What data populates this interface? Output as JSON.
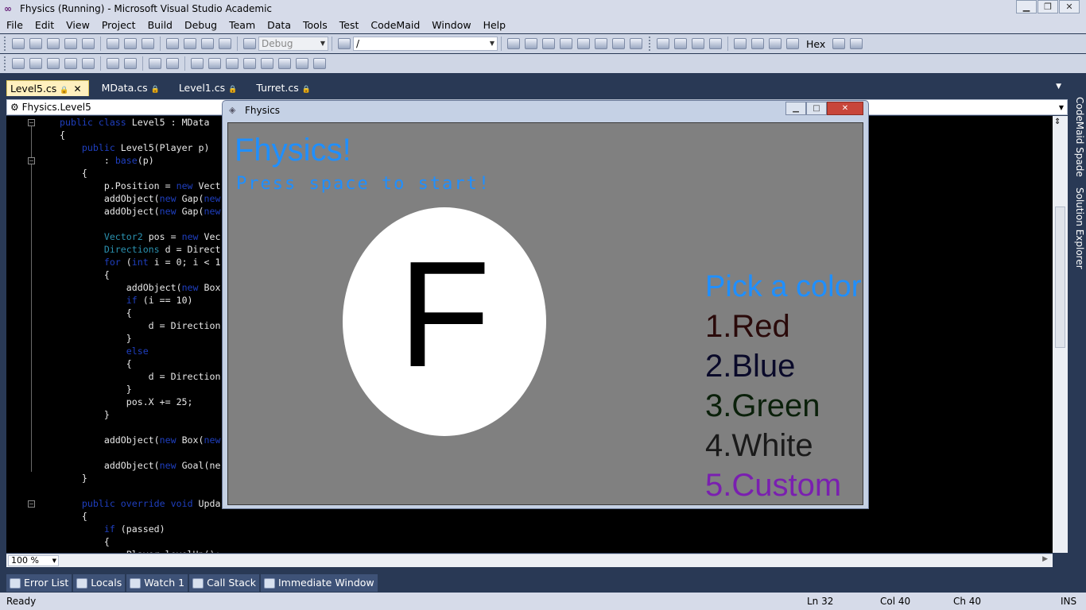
{
  "window": {
    "title": "Fhysics (Running) - Microsoft Visual Studio Academic"
  },
  "menu": [
    "File",
    "Edit",
    "View",
    "Project",
    "Build",
    "Debug",
    "Team",
    "Data",
    "Tools",
    "Test",
    "CodeMaid",
    "Window",
    "Help"
  ],
  "toolbar": {
    "config": "Debug",
    "find": "/",
    "hex_label": "Hex"
  },
  "tabs": [
    {
      "label": "Level5.cs",
      "active": true
    },
    {
      "label": "MData.cs",
      "active": false
    },
    {
      "label": "Level1.cs",
      "active": false
    },
    {
      "label": "Turret.cs",
      "active": false
    }
  ],
  "navbar": {
    "type": "Fhysics.Level5"
  },
  "code": {
    "lines": [
      "public class Level5 : MData",
      "{",
      "    public Level5(Player p)",
      "        : base(p)",
      "    {",
      "        p.Position = new Vect",
      "        addObject(new Gap(new",
      "        addObject(new Gap(new",
      "",
      "        Vector2 pos = new Vec",
      "        Directions d = Direct",
      "        for (int i = 0; i < 1",
      "        {",
      "            addObject(new Box",
      "            if (i == 10)",
      "            {",
      "                d = Direction",
      "            }",
      "            else",
      "            {",
      "                d = Direction",
      "            }",
      "            pos.X += 25;",
      "        }",
      "",
      "        addObject(new Box(new",
      "",
      "        addObject(new Goal(ne",
      "    }",
      "",
      "    public override void Upda",
      "    {",
      "        if (passed)",
      "        {",
      "            Player.levelUp();"
    ]
  },
  "zoom": "100 %",
  "sidebar_right": [
    "CodeMaid Spade",
    "Solution Explorer"
  ],
  "bottom_tabs": [
    "Error List",
    "Locals",
    "Watch 1",
    "Call Stack",
    "Immediate Window"
  ],
  "status": {
    "text": "Ready",
    "line": "Ln 32",
    "col": "Col 40",
    "ch": "Ch 40",
    "mode": "INS"
  },
  "game": {
    "window_title": "Fhysics",
    "title": "Fhysics!",
    "subtitle": "Press space to start!",
    "ball_letter": "F",
    "pick_label": "Pick a color",
    "options": [
      {
        "label": "1.Red",
        "color": "#2a0a0a"
      },
      {
        "label": "2.Blue",
        "color": "#0a0a2a"
      },
      {
        "label": "3.Green",
        "color": "#0a200a"
      },
      {
        "label": "4.White",
        "color": "#1a1a1a"
      },
      {
        "label": "5.Custom",
        "color": "#7a1fb0"
      }
    ]
  }
}
